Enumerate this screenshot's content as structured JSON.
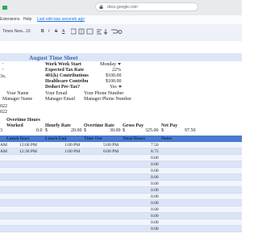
{
  "browser": {
    "url": "docs.google.com"
  },
  "menu": {
    "m1": "Extensions",
    "m2": "Help",
    "link": "Last edit was seconds ago"
  },
  "toolbar": {
    "font": "Times New...",
    "size": "10",
    "bold": "B",
    "italic": "I",
    "strike": "S",
    "underline": "A"
  },
  "sheet": {
    "title": "August Time Sheet",
    "left_marks": [
      "'",
      "'",
      "3x."
    ],
    "settings": [
      {
        "label": "Work Week Start",
        "value": "Monday"
      },
      {
        "label": "Expected Tax Rate",
        "value": "22%"
      },
      {
        "label": "401(k) Contributions",
        "value": "$100.00"
      },
      {
        "label": "Healthcare Contribu",
        "value": "$100.00"
      },
      {
        "label": "Deduct Pre-Tax?",
        "value": "Yes"
      }
    ],
    "people": {
      "name": "Your Name",
      "email": "Your Email",
      "phone": "Your Phone Number",
      "mgr_name": "Manager Name",
      "mgr_email": "Manager Email",
      "mgr_phone": "Manager Phone Number"
    },
    "years": [
      "022",
      "022"
    ],
    "summary": {
      "overtime_hours_label": "Overtime Hours",
      "labels": {
        "worked": "Worked",
        "hourly": "Hourly Rate",
        "ot_rate": "Overtime Rate",
        "gross": "Gross Pay",
        "net": "Net Pay"
      },
      "values": {
        "worked": "3",
        "overtime": "0.0",
        "hourly_sym": "$",
        "hourly": "20.00",
        "ot_sym": "$",
        "ot": "30.00",
        "gross_sym": "$",
        "gross": "325.00",
        "net_sym": "$",
        "net": "97.50"
      }
    },
    "table": {
      "headers": [
        "Lunch Start",
        "Lunch End",
        "Time Out",
        "Total Hours",
        "Notes"
      ],
      "rows": [
        {
          "a": "AM",
          "lunch_start": "12:00 PM",
          "lunch_end": "1:00 PM",
          "time_out": "5:00 PM",
          "total": "7.50"
        },
        {
          "a": "AM",
          "lunch_start": "12:30 PM",
          "lunch_end": "1:00 PM",
          "time_out": "6:00 PM",
          "total": "8.75"
        },
        {
          "total": "0.00"
        },
        {
          "total": "0.00"
        },
        {
          "total": "0.00"
        },
        {
          "total": "0.00"
        },
        {
          "total": "0.00"
        },
        {
          "total": "0.00"
        },
        {
          "total": "0.00"
        },
        {
          "total": "0.00"
        },
        {
          "total": "0.00"
        },
        {
          "total": "0.00"
        },
        {
          "total": "0.00"
        },
        {
          "total": "0.00"
        }
      ]
    }
  }
}
